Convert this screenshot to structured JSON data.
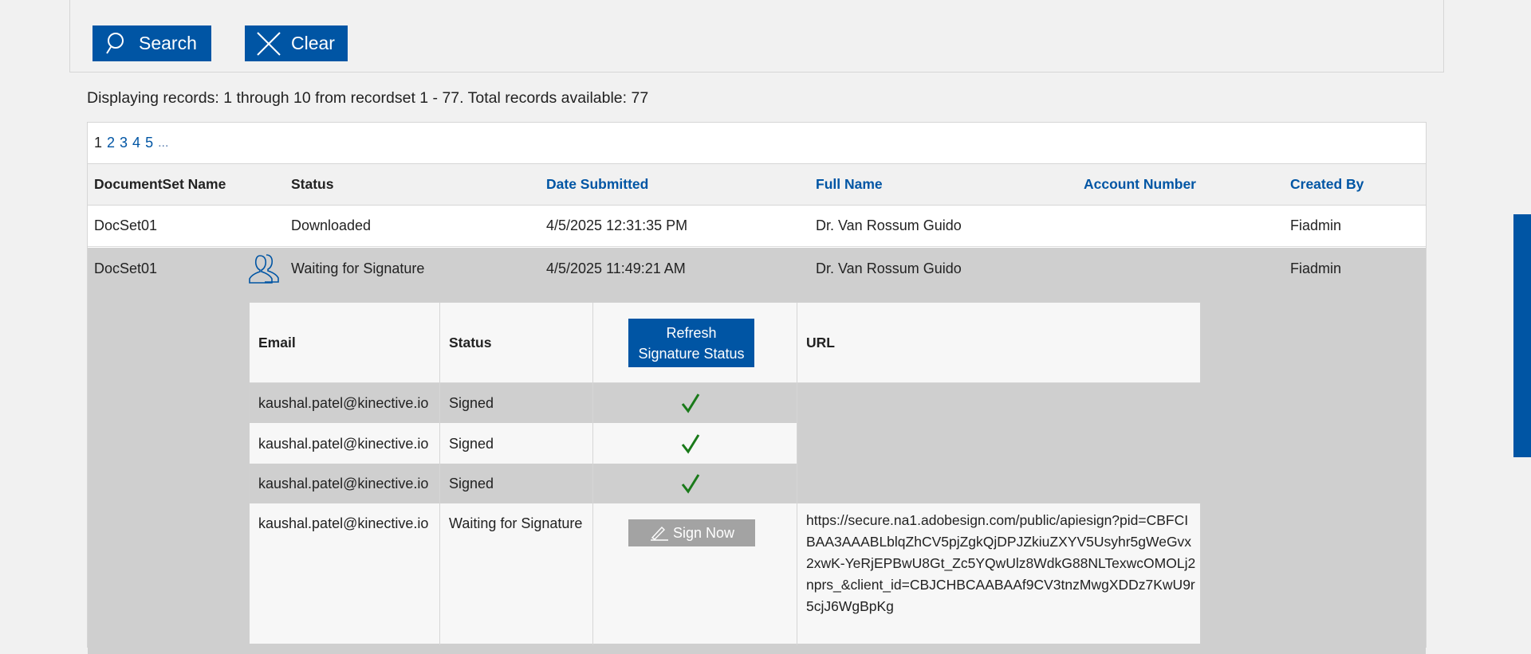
{
  "search_panel": {
    "search_label": "Search",
    "clear_label": "Clear"
  },
  "records_info": "Displaying records: 1 through 10 from recordset 1 - 77. Total records available: 77",
  "pager": {
    "current": "1",
    "pages": [
      "2",
      "3",
      "4",
      "5"
    ],
    "more": "..."
  },
  "table": {
    "headers": {
      "docset_name": "DocumentSet Name",
      "status": "Status",
      "date_submitted": "Date Submitted",
      "full_name": "Full Name",
      "account_number": "Account Number",
      "created_by": "Created By"
    },
    "rows": [
      {
        "docset_name": "DocSet01",
        "status": "Downloaded",
        "date_submitted": "4/5/2025 12:31:35 PM",
        "full_name": "Dr. Van Rossum Guido",
        "account_number": "",
        "created_by": "Fiadmin"
      },
      {
        "docset_name": "DocSet01",
        "status": "Waiting for Signature",
        "date_submitted": "4/5/2025 11:49:21 AM",
        "full_name": "Dr. Van Rossum Guido",
        "account_number": "",
        "created_by": "Fiadmin",
        "icon": "person-icon"
      }
    ]
  },
  "signers": {
    "headers": {
      "email": "Email",
      "status": "Status",
      "refresh_line1": "Refresh",
      "refresh_line2": "Signature Status",
      "url": "URL"
    },
    "rows": [
      {
        "email": "kaushal.patel@kinective.io",
        "status": "Signed",
        "icon": "checkmark-icon"
      },
      {
        "email": "kaushal.patel@kinective.io",
        "status": "Signed",
        "icon": "checkmark-icon"
      },
      {
        "email": "kaushal.patel@kinective.io",
        "status": "Signed",
        "icon": "checkmark-icon"
      },
      {
        "email": "kaushal.patel@kinective.io",
        "status": "Waiting for Signature",
        "action": "Sign Now",
        "url": "https://secure.na1.adobesign.com/public/apiesign?pid=CBFCIBAA3AAABLblqZhCV5pjZgkQjDPJZkiuZXYV5Usyhr5gWeGvx2xwK-YeRjEPBwU8Gt_Zc5YQwUlz8WdkG88NLTexwcOMOLj2nprs_&client_id=CBJCHBCAABAAf9CV3tnzMwgXDDz7KwU9r5cjJ6WgBpKg"
      }
    ]
  },
  "colors": {
    "accent": "#0055a4",
    "check": "#1a7a1a",
    "row_highlight": "#cfcfcf"
  }
}
